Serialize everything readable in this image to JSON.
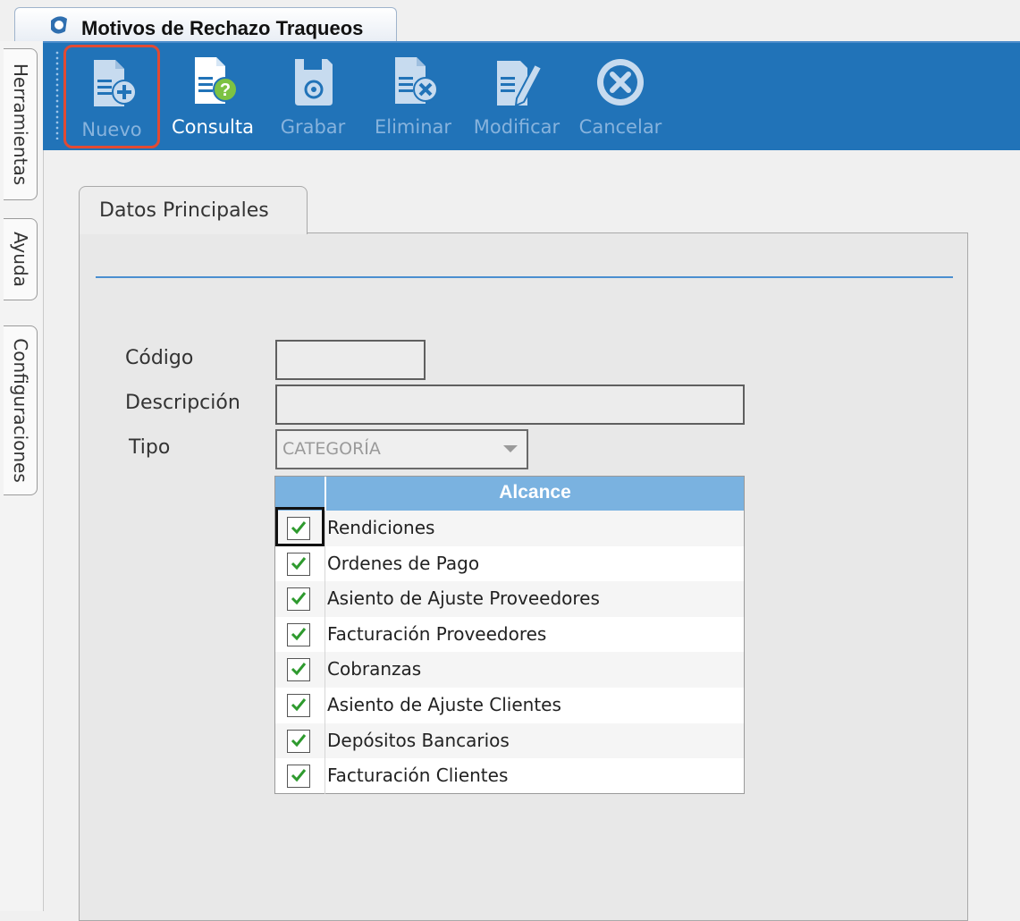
{
  "window": {
    "title": "Motivos de Rechazo Traqueos"
  },
  "toolbar": {
    "buttons": [
      {
        "label": "Nuevo",
        "icon": "new-document-icon",
        "enabled": false,
        "highlighted": true
      },
      {
        "label": "Consulta",
        "icon": "query-document-icon",
        "enabled": true
      },
      {
        "label": "Grabar",
        "icon": "save-icon",
        "enabled": false
      },
      {
        "label": "Eliminar",
        "icon": "delete-document-icon",
        "enabled": false
      },
      {
        "label": "Modificar",
        "icon": "edit-document-icon",
        "enabled": false
      },
      {
        "label": "Cancelar",
        "icon": "cancel-icon",
        "enabled": false
      }
    ]
  },
  "side_tabs": [
    "Herramientas",
    "Ayuda",
    "Configuraciones"
  ],
  "section_tab": "Datos Principales",
  "form": {
    "codigo": {
      "label": "Código",
      "value": ""
    },
    "descripcion": {
      "label": "Descripción",
      "value": ""
    },
    "tipo": {
      "label": "Tipo",
      "value": "CATEGORÍA"
    }
  },
  "grid": {
    "header": "Alcance",
    "rows": [
      {
        "label": "Rendiciones",
        "checked": true
      },
      {
        "label": "Ordenes de Pago",
        "checked": true
      },
      {
        "label": "Asiento de Ajuste Proveedores",
        "checked": true
      },
      {
        "label": "Facturación Proveedores",
        "checked": true
      },
      {
        "label": "Cobranzas",
        "checked": true
      },
      {
        "label": "Asiento de Ajuste Clientes",
        "checked": true
      },
      {
        "label": "Depósitos Bancarios",
        "checked": true
      },
      {
        "label": "Facturación Clientes",
        "checked": true
      }
    ]
  },
  "colors": {
    "toolbar": "#2173b8",
    "grid_header": "#7ab2e0",
    "highlight": "#e24a33",
    "check": "#2e9a2e"
  }
}
